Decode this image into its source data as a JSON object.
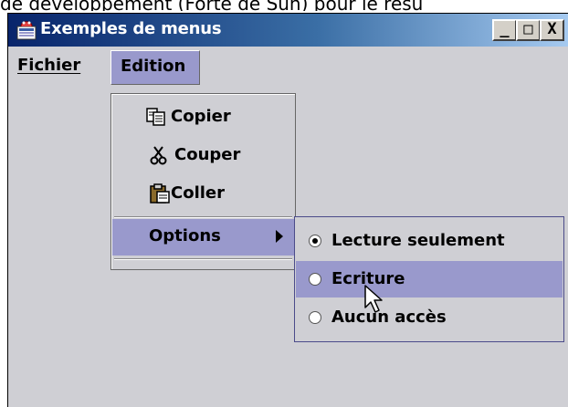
{
  "caption": "de développement (Forte de Sun) pour le résu",
  "window": {
    "title": "Exemples de menus",
    "controls": {
      "minimize": "_",
      "maximize": "□",
      "close": "X"
    }
  },
  "menubar": {
    "items": [
      {
        "label": "Fichier",
        "mnemonic": "F"
      },
      {
        "label": "Edition",
        "state": "open"
      }
    ]
  },
  "edition_menu": {
    "items": [
      {
        "label": "Copier",
        "icon": "copy-icon"
      },
      {
        "label": "Couper",
        "icon": "scissors-icon"
      },
      {
        "label": "Coller",
        "icon": "paste-icon"
      },
      {
        "label": "Options",
        "submenu": true,
        "state": "highlighted"
      }
    ]
  },
  "options_submenu": {
    "items": [
      {
        "label": "Lecture seulement",
        "selected": true
      },
      {
        "label": "Ecriture",
        "selected": false,
        "state": "highlighted"
      },
      {
        "label": "Aucun accès",
        "selected": false
      }
    ]
  },
  "colors": {
    "menu_highlight": "#9999cc",
    "window_bg": "#cfcfd4",
    "title_start": "#08246b",
    "title_end": "#a6caf0"
  }
}
